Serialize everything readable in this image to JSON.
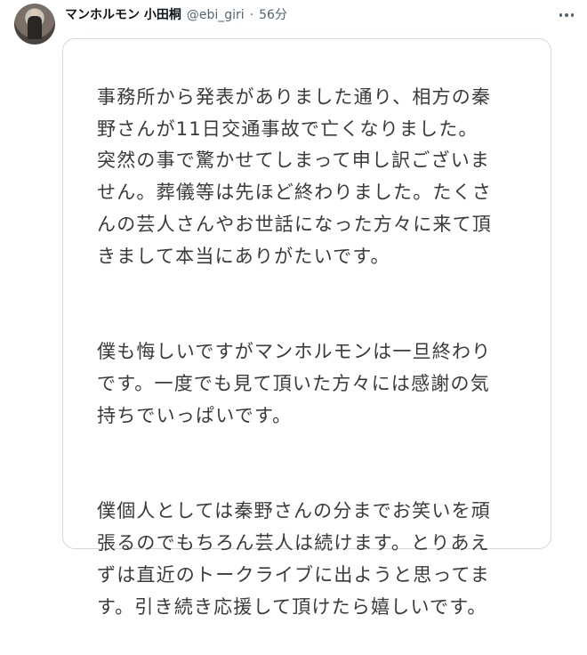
{
  "tweet": {
    "display_name": "マンホルモン 小田桐",
    "handle": "@ebi_giri",
    "separator": "·",
    "time": "56分",
    "more_icon": "more-horizontal-icon"
  },
  "image_text": {
    "paragraphs": [
      "事務所から発表がありました通り、相方の秦\n野さんが11日交通事故で亡くなりました。\n突然の事で驚かせてしまって申し訳ございま\nせん。葬儀等は先ほど終わりました。たくさ\nんの芸人さんやお世話になった方々に来て頂\nきまして本当にありがたいです。",
      "僕も悔しいですがマンホルモンは一旦終わり\nです。一度でも見て頂いた方々には感謝の気\n持ちでいっぱいです。",
      "僕個人としては秦野さんの分までお笑いを頑\n張るのでもちろん芸人は続けます。とりあえ\nずは直近のトークライブに出ようと思ってま\nす。引き続き応援して頂けたら嬉しいです。"
    ]
  }
}
